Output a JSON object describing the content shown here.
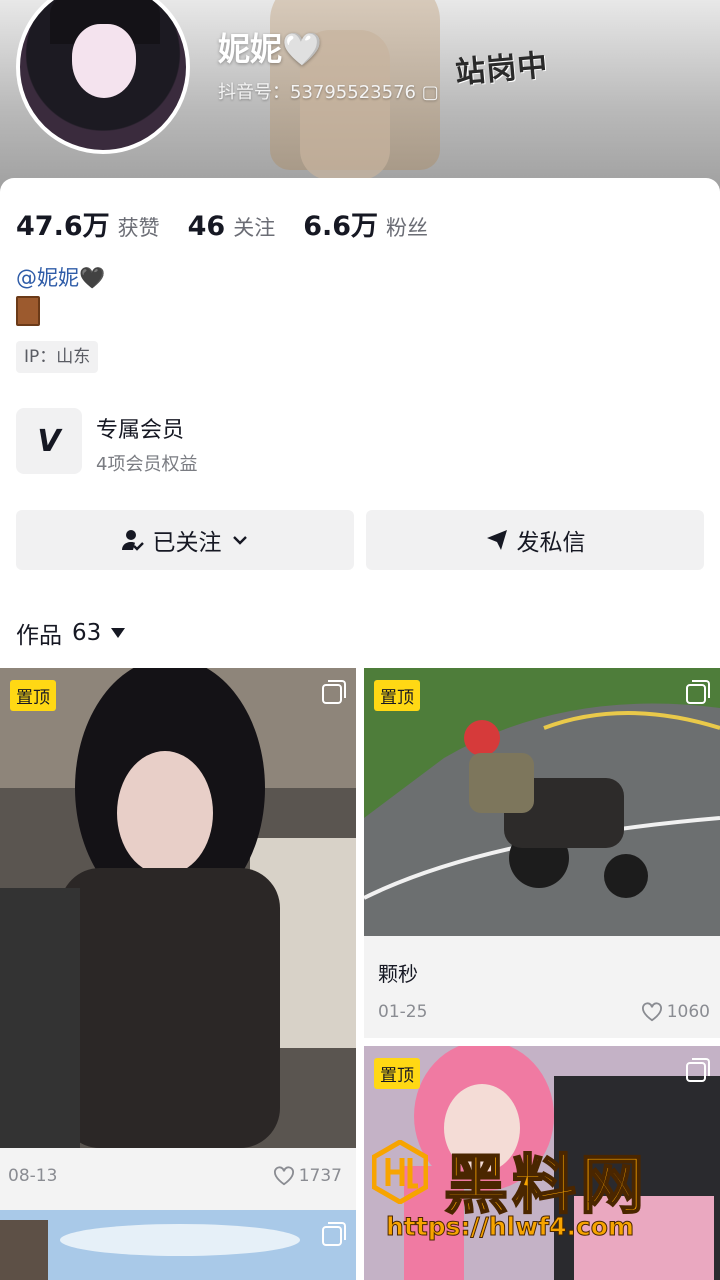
{
  "header": {
    "nickname": "妮妮🤍",
    "douyin_id": "抖音号：53795523576 ▢",
    "cover_stamp": "站岗中"
  },
  "stats": [
    {
      "value": "47.6万",
      "label": "获赞"
    },
    {
      "value": "46",
      "label": "关注"
    },
    {
      "value": "6.6万",
      "label": "粉丝"
    }
  ],
  "bio": {
    "mention": "@妮妮🖤",
    "emoji_icon": "door-icon",
    "ip": "IP：山东"
  },
  "membership": {
    "icon": "v-logo-icon",
    "title": "专属会员",
    "subtitle": "4项会员权益"
  },
  "actions": {
    "follow_label": "已关注",
    "message_label": "发私信"
  },
  "works": {
    "tab_label": "作品",
    "count": "63"
  },
  "grid": [
    {
      "pin": "置顶",
      "date": "08-13",
      "likes": "1737",
      "title": ""
    },
    {
      "pin": "置顶",
      "date": "01-25",
      "likes": "1060",
      "title": "颗秒"
    },
    {
      "pin": "置顶",
      "date": "",
      "likes": "",
      "title": ""
    },
    {
      "pin": "",
      "date": "",
      "likes": "",
      "title": ""
    }
  ],
  "watermark": {
    "brand": "黑料网",
    "url": "https://hlwf4.com"
  },
  "colors": {
    "pin_badge": "#ffd814",
    "mention_link": "#2f5ca8",
    "button_bg": "#f1f1f2",
    "watermark": "#f7a400"
  }
}
